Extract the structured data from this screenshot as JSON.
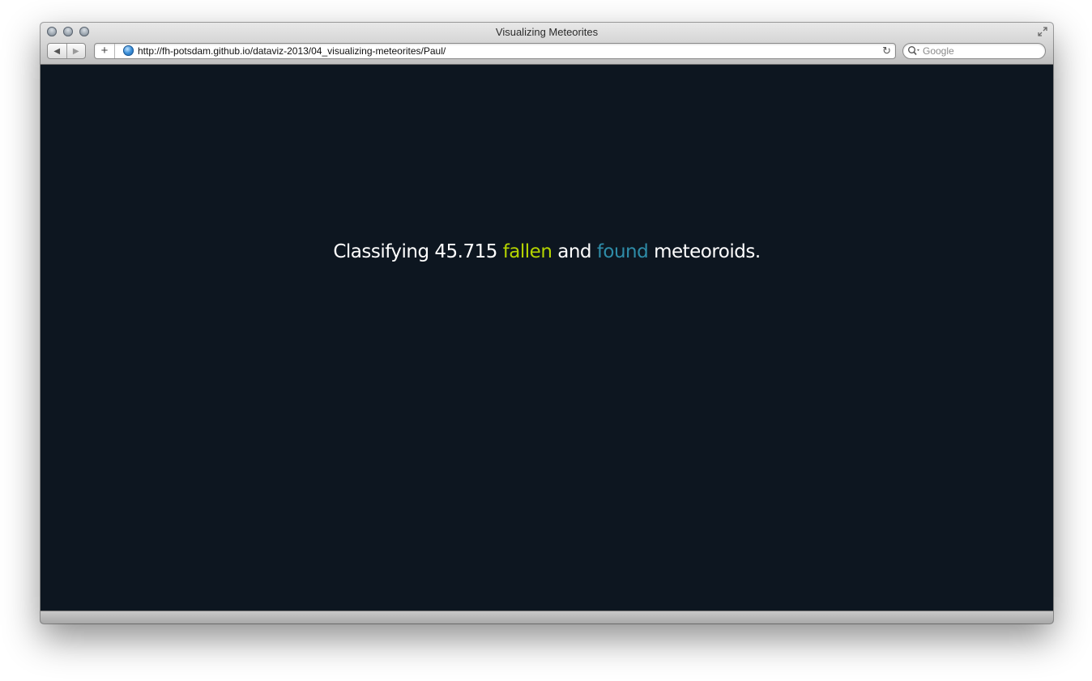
{
  "window": {
    "title": "Visualizing Meteorites"
  },
  "toolbar": {
    "back_icon": "◀",
    "forward_icon": "▶",
    "add_icon": "+",
    "url": "http://fh-potsdam.github.io/dataviz-2013/04_visualizing-meteorites/Paul/",
    "reload_icon": "↻",
    "search_placeholder": "Google"
  },
  "page": {
    "headline_prefix": "Classifying 45.715",
    "word_fallen": "fallen",
    "word_and": "and",
    "word_found": "found",
    "headline_suffix": "meteoroids.",
    "background_color": "#0d1620",
    "fallen_color": "#b5d400",
    "found_color": "#2e8ca8"
  }
}
